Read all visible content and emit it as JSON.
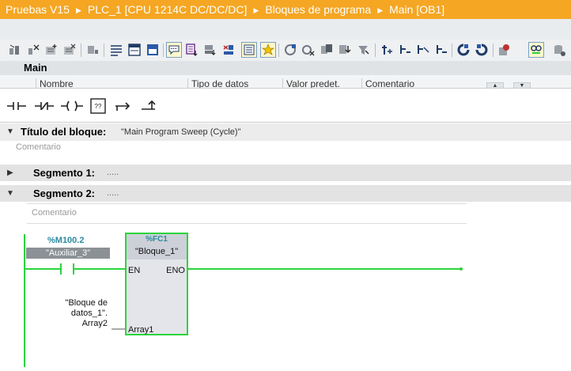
{
  "breadcrumb": [
    "Pruebas V15",
    "PLC_1 [CPU 1214C DC/DC/DC]",
    "Bloques de programa",
    "Main [OB1]"
  ],
  "colors": {
    "title_bar": "#f5a623",
    "wire": "#2bd43c",
    "operand_addr": "#2a8aa0",
    "tag_badge": "#8c9196"
  },
  "toolbar": {
    "icons": [
      "online-icon",
      "offline-icon",
      "insert-network-icon",
      "delete-network-icon",
      "monitor-icon",
      "network-list-icon",
      "zoom-icon",
      "view-icon",
      "show-comments-icon",
      "favorites-icon",
      "tag-info-icon",
      "swap-icon",
      "open-comments-icon",
      "next-error-icon",
      "prev-error-icon",
      "cross-ref-icon",
      "compare-icon",
      "download-icon",
      "compile-icon",
      "call-hierarchy-icon",
      "insert-icon",
      "properties-icon",
      "watch-icon",
      "monitoring-icon",
      "db-icon"
    ]
  },
  "interface": {
    "title": "Main",
    "columns": [
      "Nombre",
      "Tipo de datos",
      "Valor predet.",
      "Comentario"
    ]
  },
  "ladder_tools": [
    "normally-open-contact-icon",
    "normally-closed-contact-icon",
    "coil-icon",
    "empty-box-icon",
    "open-branch-icon",
    "close-branch-icon"
  ],
  "block": {
    "title_label": "Título del bloque:",
    "title_value": "\"Main Program Sweep (Cycle)\"",
    "comment": "Comentario"
  },
  "segments": [
    {
      "label": "Segmento 1:",
      "dots": ".....",
      "expanded": false
    },
    {
      "label": "Segmento 2:",
      "dots": ".....",
      "expanded": true,
      "comment": "Comentario"
    }
  ],
  "network2": {
    "contact": {
      "address": "%M100.2",
      "tag": "\"Auxiliar_3\""
    },
    "function_block": {
      "address": "%FC1",
      "name": "\"Bloque_1\"",
      "en": "EN",
      "eno": "ENO",
      "input": "Array1"
    },
    "parameter": [
      "\"Bloque de",
      "datos_1\".",
      "Array2"
    ]
  }
}
